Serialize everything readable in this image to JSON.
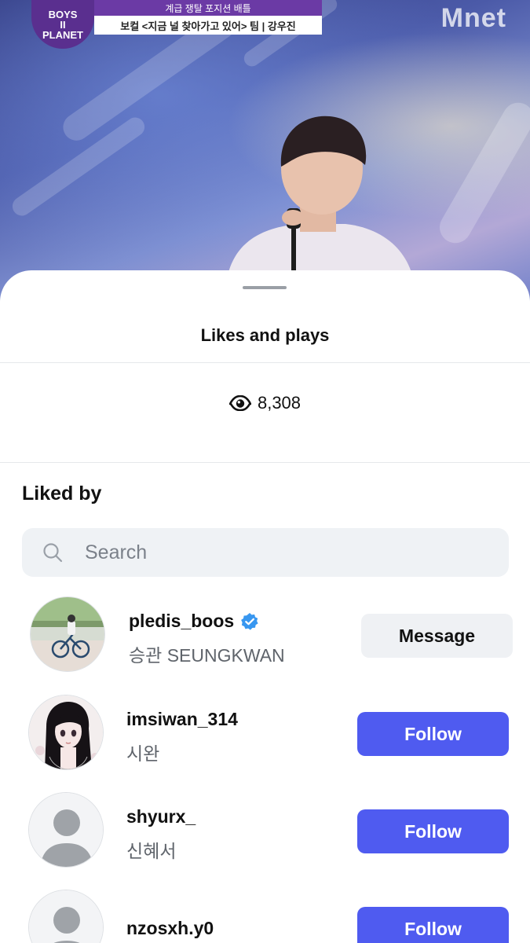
{
  "video": {
    "show_logo_lines": [
      "BOYS",
      "II",
      "PLANET"
    ],
    "caption_top": "계급 쟁탈 포지션 배틀",
    "caption_bottom": "보컬 <지금 널 찾아가고 있어> 팀 | 강우진",
    "channel": "Mnet"
  },
  "sheet": {
    "title": "Likes and plays",
    "plays_count": "8,308",
    "liked_by_label": "Liked by",
    "search": {
      "placeholder": "Search",
      "value": ""
    }
  },
  "likers": [
    {
      "username": "pledis_boos",
      "display_name": "승관 SEUNGKWAN",
      "verified": true,
      "button": "Message",
      "avatar": "photo-bicycle"
    },
    {
      "username": "imsiwan_314",
      "display_name": "시완",
      "verified": false,
      "button": "Follow",
      "avatar": "illustration-girl"
    },
    {
      "username": "shyurx_",
      "display_name": "신혜서",
      "verified": false,
      "button": "Follow",
      "avatar": "default-person"
    },
    {
      "username": "nzosxh.y0",
      "display_name": "",
      "verified": false,
      "button": "Follow",
      "avatar": "default-person"
    }
  ],
  "colors": {
    "follow_button": "#4f5bf0",
    "message_button": "#eff1f4",
    "verified_badge": "#3897f0",
    "badge_purple": "#5a2f8f"
  },
  "icons": [
    "eye-icon",
    "search-icon",
    "verified-badge-icon",
    "default-avatar-icon"
  ]
}
